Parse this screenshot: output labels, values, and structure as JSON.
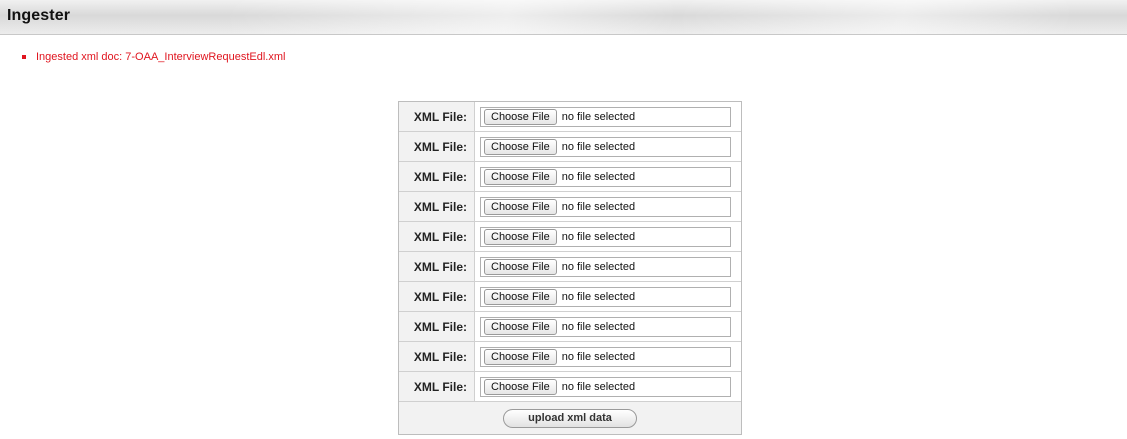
{
  "header": {
    "title": "Ingester"
  },
  "messages": [
    "Ingested xml doc: 7-OAA_InterviewRequestEdl.xml"
  ],
  "form": {
    "rows": [
      {
        "label": "XML File:",
        "button": "Choose File",
        "status": "no file selected"
      },
      {
        "label": "XML File:",
        "button": "Choose File",
        "status": "no file selected"
      },
      {
        "label": "XML File:",
        "button": "Choose File",
        "status": "no file selected"
      },
      {
        "label": "XML File:",
        "button": "Choose File",
        "status": "no file selected"
      },
      {
        "label": "XML File:",
        "button": "Choose File",
        "status": "no file selected"
      },
      {
        "label": "XML File:",
        "button": "Choose File",
        "status": "no file selected"
      },
      {
        "label": "XML File:",
        "button": "Choose File",
        "status": "no file selected"
      },
      {
        "label": "XML File:",
        "button": "Choose File",
        "status": "no file selected"
      },
      {
        "label": "XML File:",
        "button": "Choose File",
        "status": "no file selected"
      },
      {
        "label": "XML File:",
        "button": "Choose File",
        "status": "no file selected"
      }
    ],
    "submit_label": "upload xml data"
  },
  "colors": {
    "message": "#e0151f",
    "header_bg": "#d9d9d9",
    "label_bg": "#f2f2f2"
  }
}
